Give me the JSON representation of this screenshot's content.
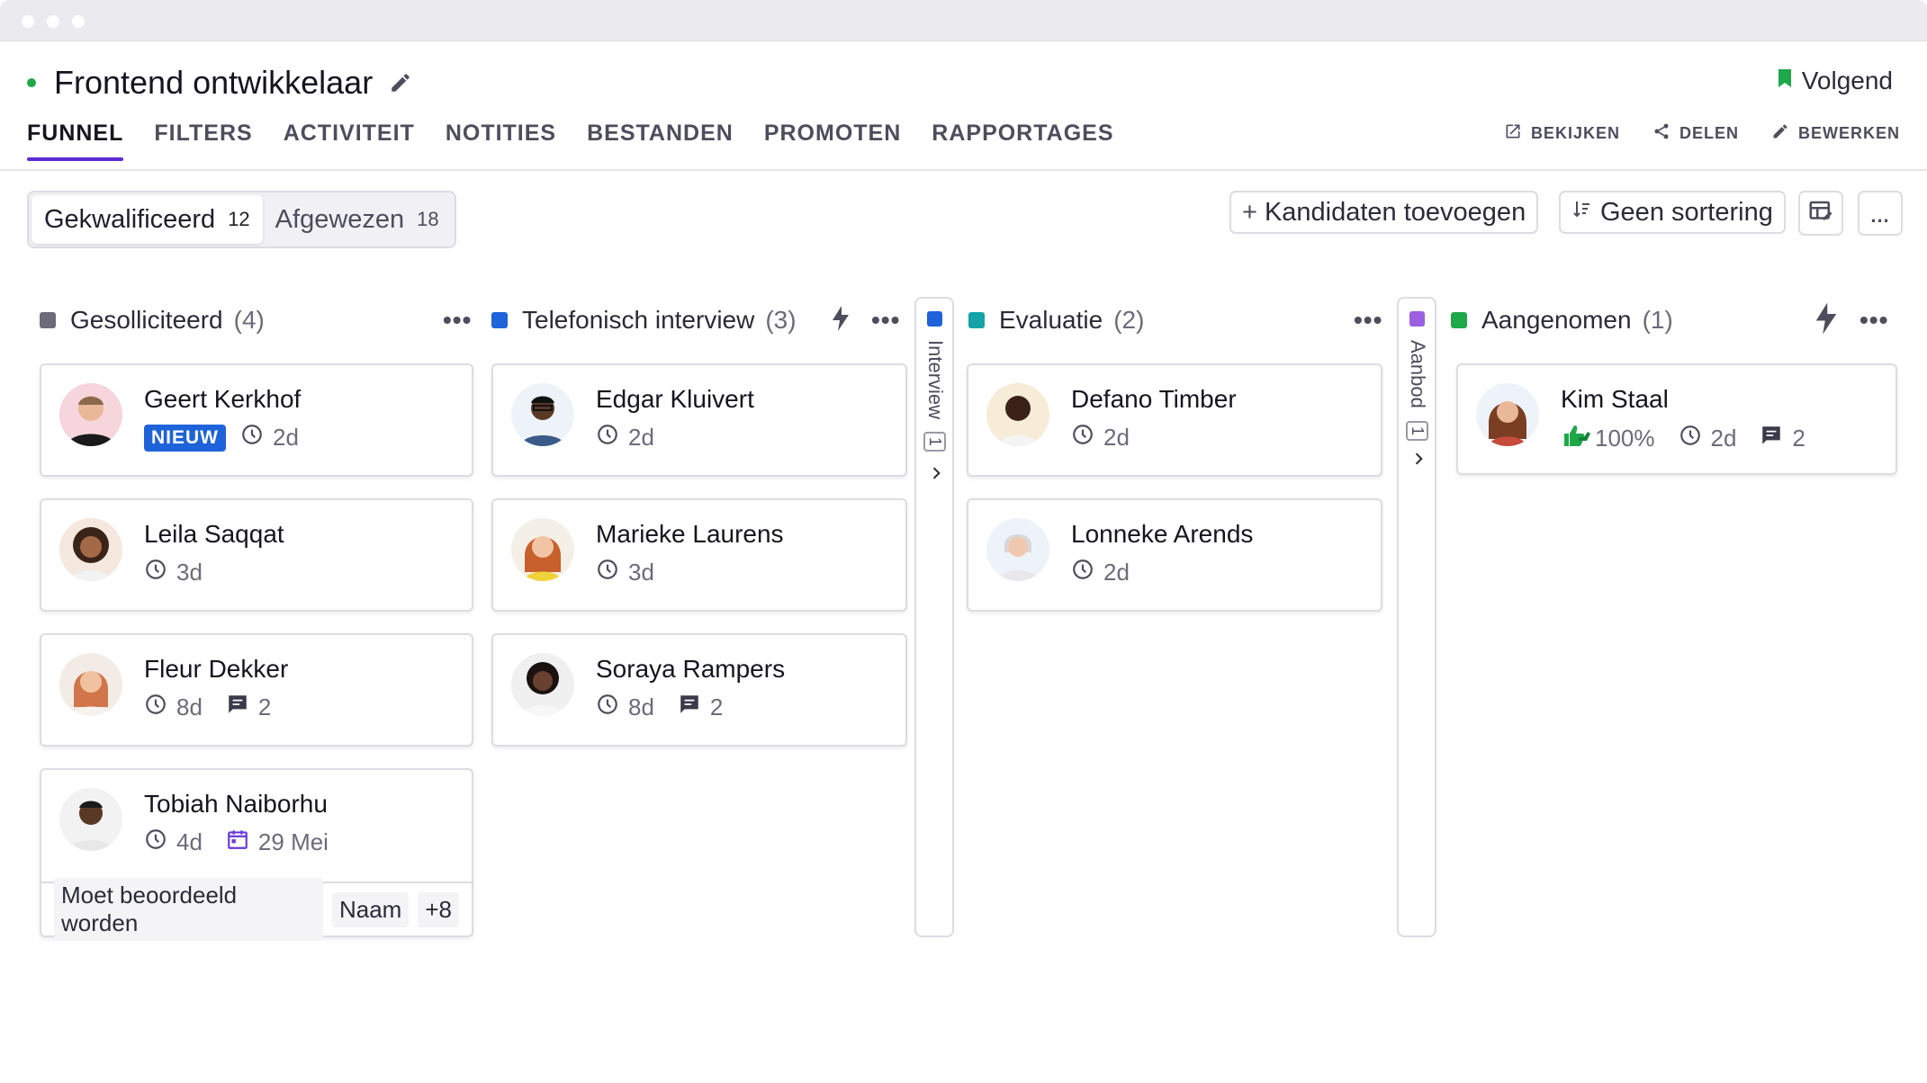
{
  "header": {
    "job_title": "Frontend ontwikkelaar",
    "follow_label": "Volgend",
    "colors": {
      "accent": "#5b2bd6",
      "status": "#1fa84a",
      "follow": "#1fa84a"
    }
  },
  "tabs": [
    {
      "label": "FUNNEL",
      "active": true
    },
    {
      "label": "FILTERS"
    },
    {
      "label": "ACTIVITEIT"
    },
    {
      "label": "NOTITIES"
    },
    {
      "label": "BESTANDEN"
    },
    {
      "label": "PROMOTEN"
    },
    {
      "label": "RAPPORTAGES"
    }
  ],
  "actions": [
    {
      "label": "BEKIJKEN",
      "icon": "external-link-icon"
    },
    {
      "label": "DELEN",
      "icon": "share-icon"
    },
    {
      "label": "BEWERKEN",
      "icon": "pencil-icon"
    }
  ],
  "toolbar": {
    "segments": [
      {
        "label": "Gekwalificeerd",
        "count": "12",
        "active": true
      },
      {
        "label": "Afgewezen",
        "count": "18"
      }
    ],
    "add_candidates": "Kandidaten toevoegen",
    "add_prefix": "+",
    "sorting": "Geen sortering",
    "more": "..."
  },
  "columns": [
    {
      "name": "Gesolliciteerd",
      "count": "(4)",
      "color": "#6b6b7a",
      "more": "•••",
      "cards": [
        {
          "name": "Geert Kerkhof",
          "badge": "NIEUW",
          "time": "2d",
          "avatar": "avatar-geert"
        },
        {
          "name": "Leila Saqqat",
          "time": "3d",
          "avatar": "avatar-leila"
        },
        {
          "name": "Fleur Dekker",
          "time": "8d",
          "comments": "2",
          "avatar": "avatar-fleur"
        },
        {
          "name": "Tobiah Naiborhu",
          "time": "4d",
          "date": "29 Mei",
          "avatar": "avatar-tobiah",
          "tags": [
            "Moet beoordeeld worden",
            "Naam",
            "+8"
          ]
        }
      ]
    },
    {
      "name": "Telefonisch interview",
      "count": "(3)",
      "color": "#1e63d9",
      "more": "•••",
      "cards": [
        {
          "name": "Edgar Kluivert",
          "time": "2d",
          "avatar": "avatar-edgar"
        },
        {
          "name": "Marieke Laurens",
          "time": "3d",
          "avatar": "avatar-marieke"
        },
        {
          "name": "Soraya Rampers",
          "time": "8d",
          "comments": "2",
          "avatar": "avatar-soraya"
        }
      ]
    },
    {
      "collapsed": true,
      "name": "Interview",
      "count": "1",
      "color": "#1e63d9"
    },
    {
      "name": "Evaluatie",
      "count": "(2)",
      "color": "#14a3a8",
      "more": "•••",
      "cards": [
        {
          "name": "Defano Timber",
          "time": "2d",
          "avatar": "avatar-defano"
        },
        {
          "name": "Lonneke Arends",
          "time": "2d",
          "avatar": "avatar-lonneke"
        }
      ]
    },
    {
      "collapsed": true,
      "name": "Aanbod",
      "count": "1",
      "color": "#9b5fe0"
    },
    {
      "name": "Aangenomen",
      "count": "(1)",
      "color": "#1fa84a",
      "more": "•••",
      "cards": [
        {
          "name": "Kim Staal",
          "score": "100%",
          "time": "2d",
          "comments": "2",
          "avatar": "avatar-kim"
        }
      ]
    }
  ]
}
